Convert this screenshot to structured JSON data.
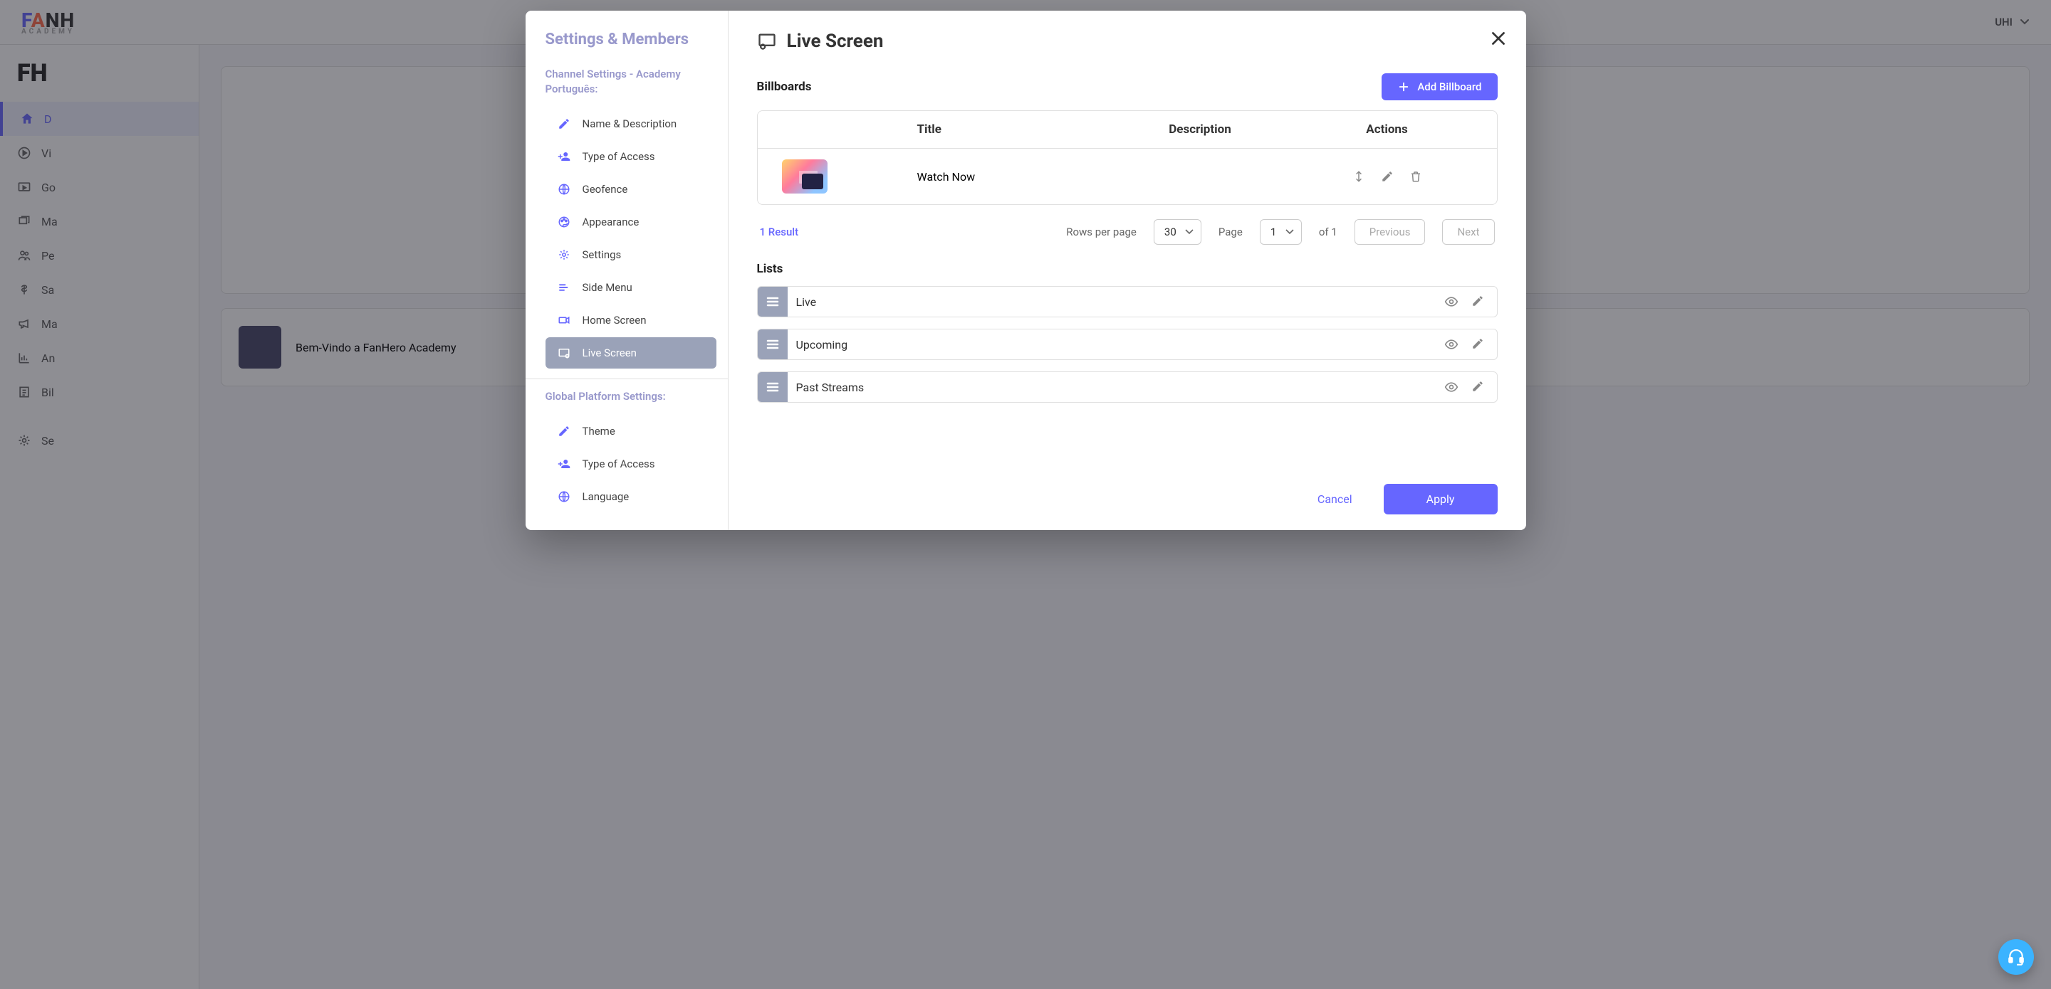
{
  "topbar": {
    "user": "UHI"
  },
  "sidebar_bg": {
    "dashboard": "D",
    "videos": "Vi",
    "go": "Go",
    "manage": "Ma",
    "people": "Pe",
    "sales": "Sa",
    "marketing": "Ma",
    "analytics": "An",
    "billing": "Bil",
    "settings": "Se"
  },
  "modal": {
    "sidebar_title": "Settings & Members",
    "group1": "Channel Settings - Academy Português:",
    "group2": "Global Platform Settings:",
    "items": {
      "name_desc": "Name & Description",
      "type_access": "Type of Access",
      "geofence": "Geofence",
      "appearance": "Appearance",
      "settings": "Settings",
      "side_menu": "Side Menu",
      "home_screen": "Home Screen",
      "live_screen": "Live Screen",
      "theme": "Theme",
      "type_access2": "Type of Access",
      "language": "Language"
    },
    "header": "Live Screen",
    "billboards": {
      "label": "Billboards",
      "add_btn": "Add Billboard",
      "columns": {
        "title": "Title",
        "description": "Description",
        "actions": "Actions"
      },
      "rows": [
        {
          "title": "Watch Now",
          "description": ""
        }
      ],
      "result_text": "1 Result",
      "rows_per_page_label": "Rows per page",
      "rows_per_page": "30",
      "page_label": "Page",
      "page": "1",
      "of_text": "of 1",
      "prev": "Previous",
      "next": "Next"
    },
    "lists": {
      "label": "Lists",
      "items": [
        "Live",
        "Upcoming",
        "Past Streams"
      ]
    },
    "footer": {
      "cancel": "Cancel",
      "apply": "Apply"
    }
  },
  "colors": {
    "accent": "#6666ff",
    "handle": "#9aa2b8",
    "fab": "#3bb3ff"
  },
  "under_content": {
    "card_text": "Bem-Vindo a FanHero Academy"
  }
}
